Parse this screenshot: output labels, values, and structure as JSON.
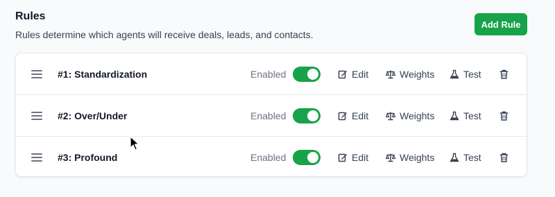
{
  "header": {
    "title": "Rules",
    "subtitle": "Rules determine which agents will receive deals, leads, and contacts.",
    "add_button_label": "Add Rule"
  },
  "rules": [
    {
      "name": "#1: Standardization",
      "status": "Enabled",
      "enabled": true,
      "actions": {
        "edit": "Edit",
        "weights": "Weights",
        "test": "Test"
      }
    },
    {
      "name": "#2: Over/Under",
      "status": "Enabled",
      "enabled": true,
      "actions": {
        "edit": "Edit",
        "weights": "Weights",
        "test": "Test"
      }
    },
    {
      "name": "#3: Profound",
      "status": "Enabled",
      "enabled": true,
      "actions": {
        "edit": "Edit",
        "weights": "Weights",
        "test": "Test"
      }
    }
  ],
  "colors": {
    "accent": "#16a34a",
    "text_primary": "#111827",
    "text_muted": "#6b7280"
  },
  "icons": {
    "drag": "drag-handle-icon",
    "edit": "edit-icon",
    "weights": "scale-icon",
    "test": "flask-icon",
    "delete": "trash-icon"
  }
}
